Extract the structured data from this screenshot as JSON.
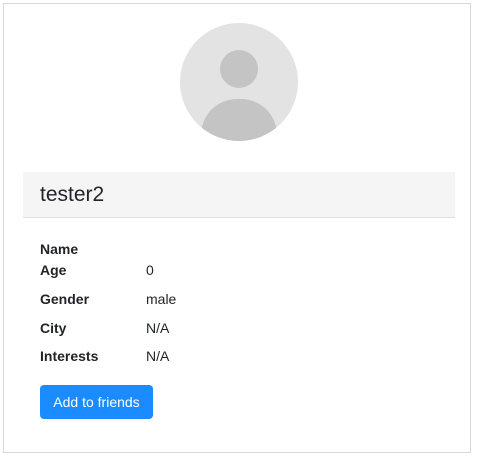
{
  "profile": {
    "avatar_icon": "user-avatar-placeholder-icon",
    "username": "tester2",
    "fields": [
      {
        "label": "Name",
        "value": ""
      },
      {
        "label": "Age",
        "value": "0"
      },
      {
        "label": "Gender",
        "value": "male"
      },
      {
        "label": "City",
        "value": "N/A"
      },
      {
        "label": "Interests",
        "value": "N/A"
      }
    ],
    "add_friend_label": "Add to friends"
  },
  "colors": {
    "button": "#1a8cff",
    "header_bg": "#f5f5f5",
    "avatar_bg": "#e3e3e3",
    "avatar_fg": "#c4c4c4"
  }
}
